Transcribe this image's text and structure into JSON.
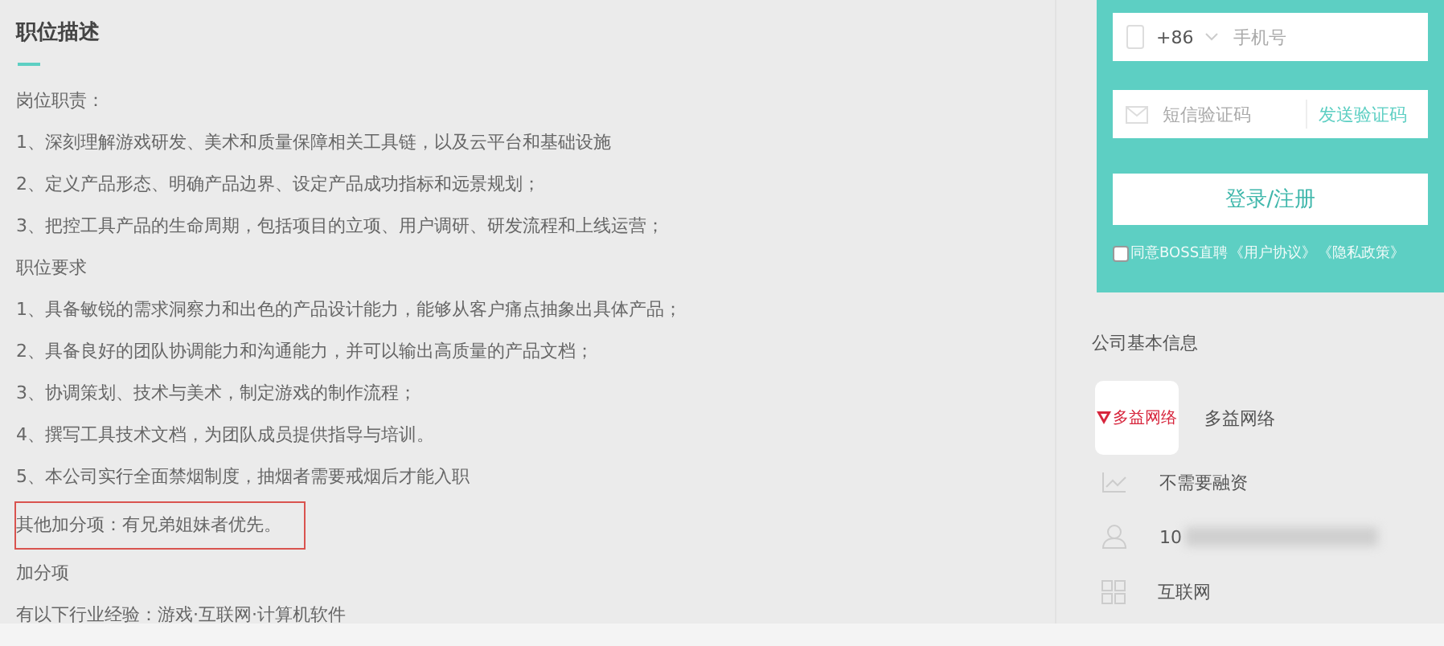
{
  "job_description": {
    "title": "职位描述",
    "paragraphs": [
      {
        "text": "岗位职责：",
        "highlighted": false
      },
      {
        "text": "1、深刻理解游戏研发、美术和质量保障相关工具链，以及云平台和基础设施",
        "highlighted": false
      },
      {
        "text": "2、定义产品形态、明确产品边界、设定产品成功指标和远景规划；",
        "highlighted": false
      },
      {
        "text": "3、把控工具产品的生命周期，包括项目的立项、用户调研、研发流程和上线运营；",
        "highlighted": false
      },
      {
        "text": "职位要求",
        "highlighted": false
      },
      {
        "text": "1、具备敏锐的需求洞察力和出色的产品设计能力，能够从客户痛点抽象出具体产品；",
        "highlighted": false
      },
      {
        "text": "2、具备良好的团队协调能力和沟通能力，并可以输出高质量的产品文档；",
        "highlighted": false
      },
      {
        "text": "3、协调策划、技术与美术，制定游戏的制作流程；",
        "highlighted": false
      },
      {
        "text": "4、撰写工具技术文档，为团队成员提供指导与培训。",
        "highlighted": false
      },
      {
        "text": "5、本公司实行全面禁烟制度，抽烟者需要戒烟后才能入职",
        "highlighted": false
      },
      {
        "text": "其他加分项：有兄弟姐妹者优先。",
        "highlighted": true
      },
      {
        "text": "加分项",
        "highlighted": false
      },
      {
        "text": "有以下行业经验：游戏·互联网·计算机软件",
        "highlighted": false
      }
    ]
  },
  "login": {
    "country_code": "+86",
    "phone_placeholder": "手机号",
    "code_placeholder": "短信验证码",
    "send_code": "发送验证码",
    "submit": "登录/注册",
    "agreement": {
      "checked": false,
      "text": "同意BOSS直聘",
      "user_agreement": "《用户协议》",
      "privacy": "《隐私政策》"
    }
  },
  "company": {
    "title": "公司基本信息",
    "logo_text": "多益网络",
    "name": "多益网络",
    "facts": [
      {
        "kind": "funding",
        "text": "不需要融资",
        "blurred": false
      },
      {
        "kind": "size",
        "text": "10",
        "blurred": true
      },
      {
        "kind": "industry",
        "text": "互联网",
        "blurred": false
      }
    ]
  }
}
